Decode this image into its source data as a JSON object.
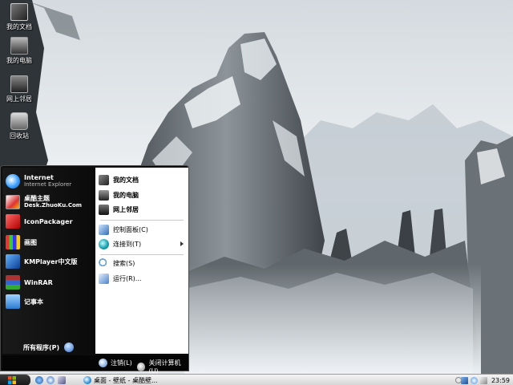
{
  "desktop": {
    "icons": [
      {
        "label": "我的文档"
      },
      {
        "label": "我的电脑"
      },
      {
        "label": "网上邻居"
      },
      {
        "label": "回收站"
      }
    ]
  },
  "start_menu": {
    "pinned": [
      {
        "label": "Internet",
        "sub": "Internet Explorer"
      },
      {
        "label": "桌酷主题",
        "sub": "Desk.ZhuoKu.Com"
      },
      {
        "label": "IconPackager"
      },
      {
        "label": "画图"
      },
      {
        "label": "KMPlayer中文版"
      },
      {
        "label": "WinRAR"
      },
      {
        "label": "记事本"
      }
    ],
    "all_programs": "所有程序(P)",
    "places": [
      {
        "label": "我的文档"
      },
      {
        "label": "我的电脑"
      },
      {
        "label": "网上邻居"
      }
    ],
    "system": [
      {
        "label": "控制面板(C)"
      },
      {
        "label": "连接到(T)"
      }
    ],
    "tools": [
      {
        "label": "搜索(S)"
      },
      {
        "label": "运行(R)..."
      }
    ],
    "logoff": "注销(L)",
    "shutdown": "关闭计算机(U)"
  },
  "taskbar": {
    "window_title": "桌面 - 壁纸 - 桌酷壁...",
    "clock": "23:59"
  },
  "colors": {
    "start_menu_bg": "#0d0d0d",
    "taskbar_bg": "#e2e2e2",
    "accent_blue": "#2e6fd0"
  }
}
